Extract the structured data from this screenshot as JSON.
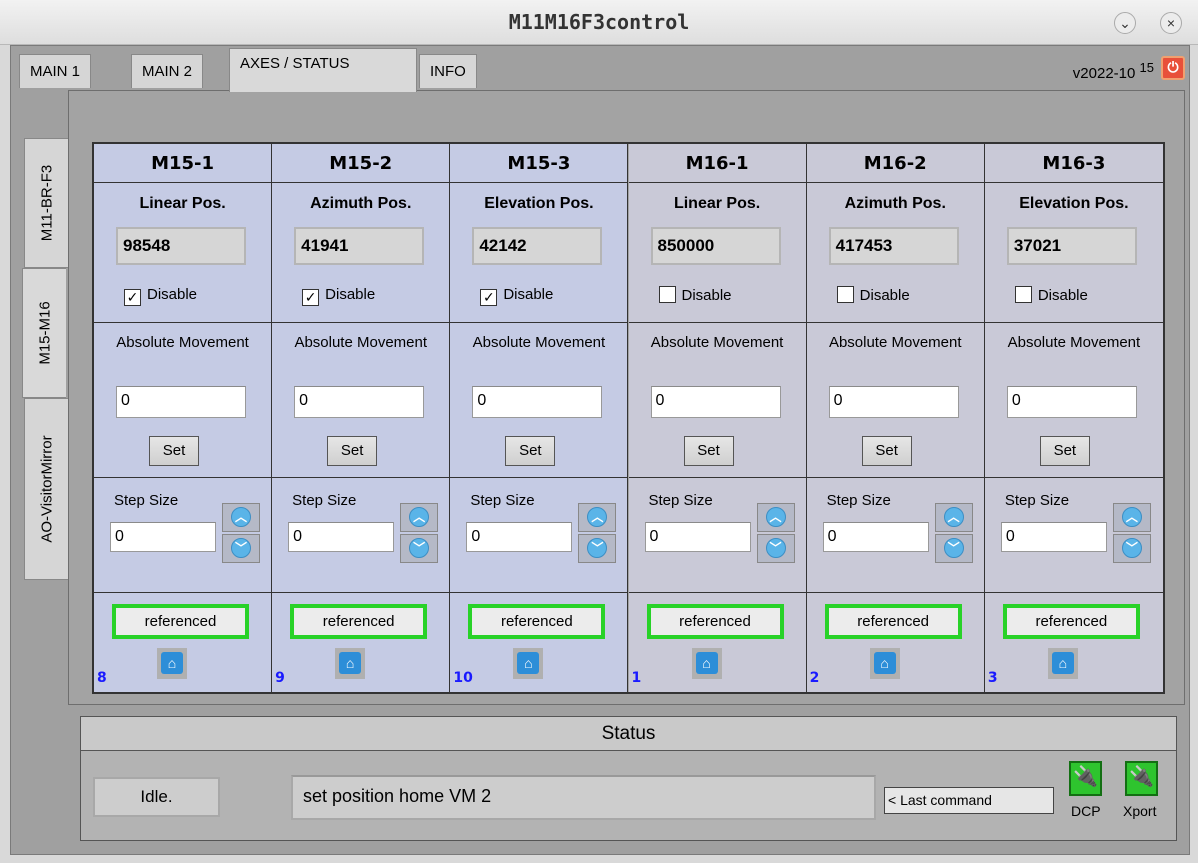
{
  "window": {
    "title": "M11M16F3control",
    "minimize_glyph": "⌄",
    "close_glyph": "×"
  },
  "tabs": [
    {
      "label": "MAIN 1",
      "active": false
    },
    {
      "label": "MAIN 2",
      "active": false
    },
    {
      "label": "AXES / STATUS",
      "active": true
    },
    {
      "label": "INFO",
      "active": false
    }
  ],
  "version": {
    "text": "v2022-10",
    "superscript": "15"
  },
  "side_tabs": [
    {
      "label": "M11-BR-F3",
      "active": false
    },
    {
      "label": "M15-M16",
      "active": true
    },
    {
      "label": "AO-VisitorMirror",
      "active": false
    }
  ],
  "labels": {
    "disable": "Disable",
    "absolute_movement": "Absolute Movement",
    "set": "Set",
    "step_size": "Step Size"
  },
  "axes": [
    {
      "name": "M15-1",
      "pos_label": "Linear Pos.",
      "position": "98548",
      "disabled": true,
      "abs_value": "0",
      "step_value": "0",
      "ref_status": "referenced",
      "index": "8",
      "group": "blue"
    },
    {
      "name": "M15-2",
      "pos_label": "Azimuth Pos.",
      "position": "41941",
      "disabled": true,
      "abs_value": "0",
      "step_value": "0",
      "ref_status": "referenced",
      "index": "9",
      "group": "blue"
    },
    {
      "name": "M15-3",
      "pos_label": "Elevation Pos.",
      "position": "42142",
      "disabled": true,
      "abs_value": "0",
      "step_value": "0",
      "ref_status": "referenced",
      "index": "10",
      "group": "blue"
    },
    {
      "name": "M16-1",
      "pos_label": "Linear Pos.",
      "position": "850000",
      "disabled": false,
      "abs_value": "0",
      "step_value": "0",
      "ref_status": "referenced",
      "index": "1",
      "group": "gray"
    },
    {
      "name": "M16-2",
      "pos_label": "Azimuth Pos.",
      "position": "417453",
      "disabled": false,
      "abs_value": "0",
      "step_value": "0",
      "ref_status": "referenced",
      "index": "2",
      "group": "gray"
    },
    {
      "name": "M16-3",
      "pos_label": "Elevation Pos.",
      "position": "37021",
      "disabled": false,
      "abs_value": "0",
      "step_value": "0",
      "ref_status": "referenced",
      "index": "3",
      "group": "gray"
    }
  ],
  "status": {
    "title": "Status",
    "state": "Idle.",
    "last_command_value": "set position home VM 2",
    "last_command_label": "< Last command",
    "connections": [
      {
        "label": "DCP",
        "icon": "plug-icon",
        "color": "#2ec42e"
      },
      {
        "label": "Xport",
        "icon": "plug-icon",
        "color": "#2ec42e"
      }
    ]
  },
  "colors": {
    "accent_green": "#28d228",
    "axis_blue_bg": "#c5cbe4",
    "axis_gray_bg": "#c9c9d7",
    "index_blue": "#1a1aff",
    "power_red": "#e8503a"
  },
  "icons": {
    "up": "chevron-up-icon",
    "down": "chevron-down-icon",
    "home": "home-icon",
    "power": "power-icon"
  }
}
